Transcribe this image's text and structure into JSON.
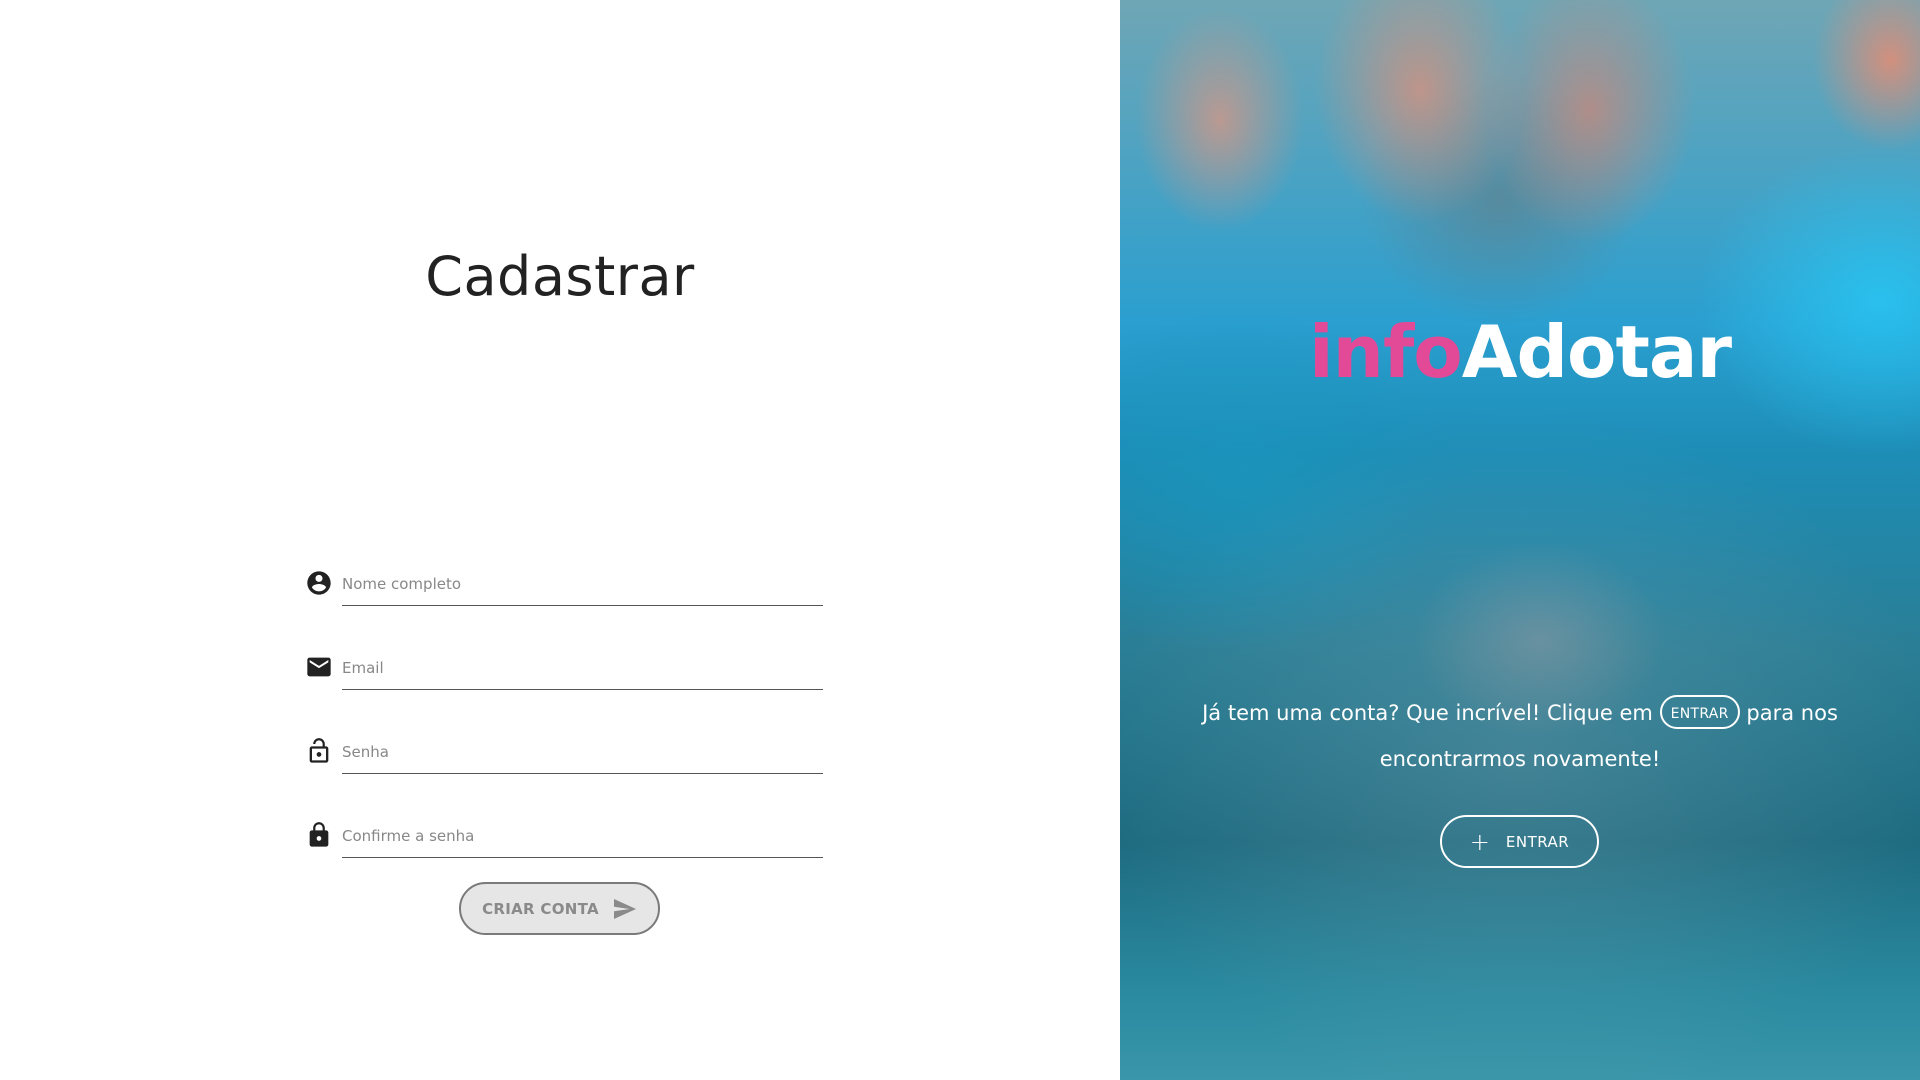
{
  "left": {
    "title": "Cadastrar",
    "fields": [
      {
        "placeholder": "Nome completo",
        "value": "",
        "icon": "account-circle-icon"
      },
      {
        "placeholder": "Email",
        "value": "",
        "icon": "mail-icon"
      },
      {
        "placeholder": "Senha",
        "value": "",
        "icon": "lock-open-icon"
      },
      {
        "placeholder": "Confirme a senha",
        "value": "",
        "icon": "lock-icon"
      }
    ],
    "submit_label": "CRIAR CONTA",
    "submit_icon": "send-icon"
  },
  "right": {
    "brand_part1": "info",
    "brand_part2": "Adotar",
    "message_before": "Já tem uma conta? Que incrível! Clique em",
    "message_inline_button": "ENTRAR",
    "message_after": "para nos encontrarmos novamente!",
    "entrar_label": "ENTRAR",
    "entrar_icon": "plus-icon"
  },
  "colors": {
    "brand_pink": "#e24a97",
    "text_dark": "#222222",
    "panel_blue": "#1d8db6"
  }
}
